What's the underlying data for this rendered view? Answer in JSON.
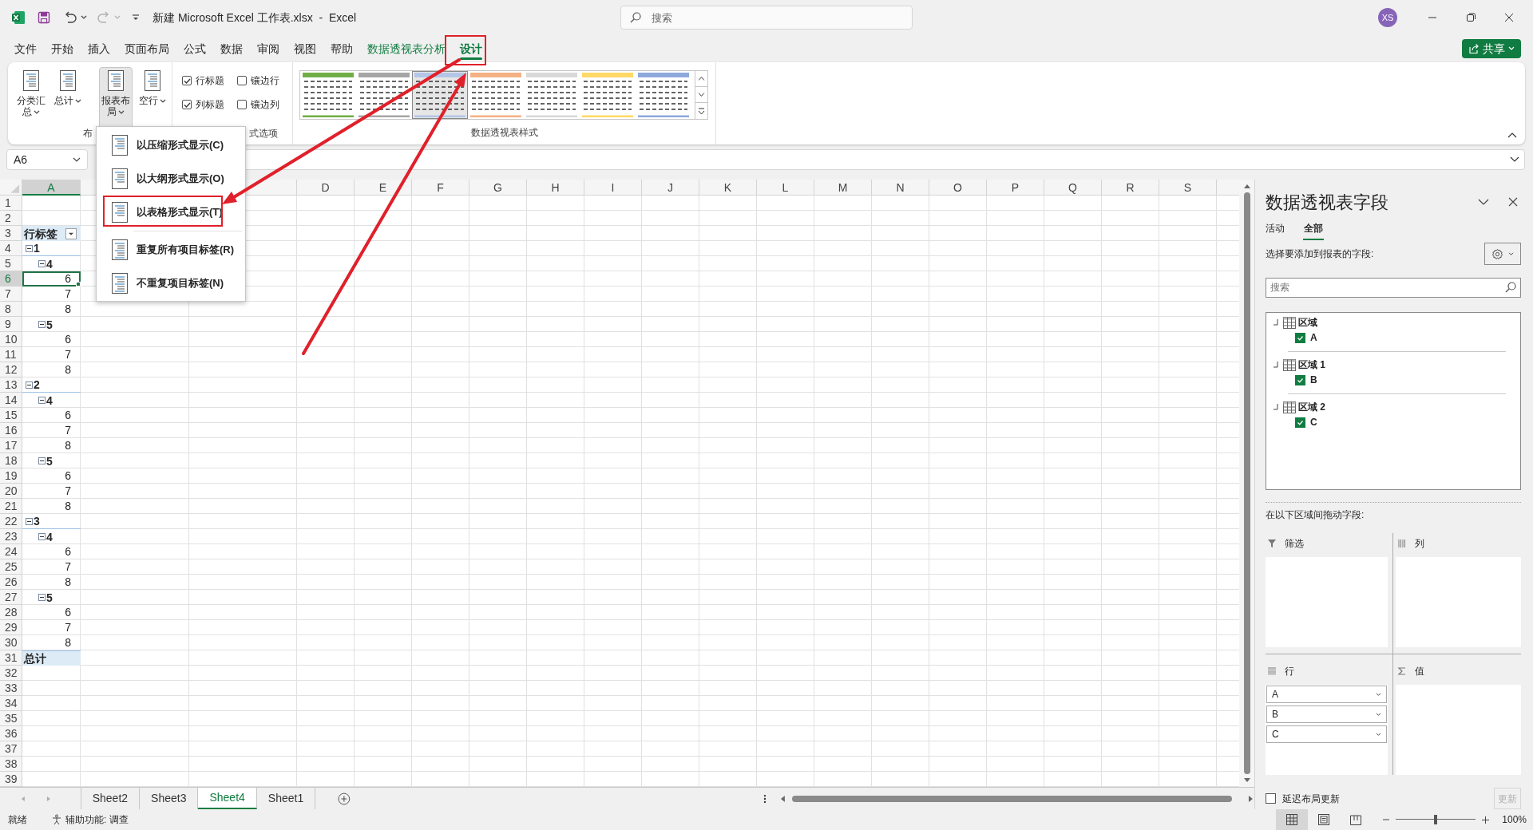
{
  "window": {
    "title": "新建 Microsoft Excel 工作表.xlsx  -  Excel",
    "search_placeholder": "搜索",
    "account": "XS"
  },
  "ribbon_tabs": [
    {
      "label": "文件",
      "selected": false,
      "contextual": false
    },
    {
      "label": "开始",
      "selected": false,
      "contextual": false
    },
    {
      "label": "插入",
      "selected": false,
      "contextual": false
    },
    {
      "label": "页面布局",
      "selected": false,
      "contextual": false
    },
    {
      "label": "公式",
      "selected": false,
      "contextual": false
    },
    {
      "label": "数据",
      "selected": false,
      "contextual": false
    },
    {
      "label": "审阅",
      "selected": false,
      "contextual": false
    },
    {
      "label": "视图",
      "selected": false,
      "contextual": false
    },
    {
      "label": "帮助",
      "selected": false,
      "contextual": false
    },
    {
      "label": "数据透视表分析",
      "selected": false,
      "contextual": true
    },
    {
      "label": "设计",
      "selected": true,
      "contextual": true
    }
  ],
  "share_button": "共享",
  "ribbon": {
    "layout_group": {
      "label": "布",
      "buttons": [
        {
          "label": "分类汇总",
          "pressed": false
        },
        {
          "label": "总计",
          "pressed": false
        },
        {
          "label": "报表布局",
          "pressed": true
        },
        {
          "label": "空行",
          "pressed": false
        }
      ]
    },
    "style_options": {
      "label": "式选项",
      "options": [
        {
          "label": "行标题",
          "checked": true
        },
        {
          "label": "镶边行",
          "checked": false
        },
        {
          "label": "列标题",
          "checked": true
        },
        {
          "label": "镶边列",
          "checked": false
        }
      ]
    },
    "styles": {
      "label": "数据透视表样式",
      "swatches": [
        {
          "color": "#70ad47",
          "selected": false
        },
        {
          "color": "#a6a6a6",
          "selected": false
        },
        {
          "color": "#b4c6e7",
          "selected": true
        },
        {
          "color": "#f4b183",
          "selected": false
        },
        {
          "color": "#d9d9d9",
          "selected": false
        },
        {
          "color": "#ffd966",
          "selected": false
        },
        {
          "color": "#8ea9db",
          "selected": false
        }
      ]
    }
  },
  "name_box": "A6",
  "layout_menu": {
    "items": [
      {
        "label": "以压缩形式显示(C)"
      },
      {
        "label": "以大纲形式显示(O)"
      },
      {
        "label": "以表格形式显示(T)"
      },
      {
        "label": "重复所有项目标签(R)"
      },
      {
        "label": "不重复项目标签(N)"
      }
    ]
  },
  "columns": [
    {
      "label": "A",
      "selected": true
    },
    {
      "label": "D",
      "selected": false
    },
    {
      "label": "E",
      "selected": false
    },
    {
      "label": "F",
      "selected": false
    },
    {
      "label": "G",
      "selected": false
    },
    {
      "label": "H",
      "selected": false
    },
    {
      "label": "I",
      "selected": false
    },
    {
      "label": "J",
      "selected": false
    },
    {
      "label": "K",
      "selected": false
    },
    {
      "label": "L",
      "selected": false
    },
    {
      "label": "M",
      "selected": false
    },
    {
      "label": "N",
      "selected": false
    },
    {
      "label": "O",
      "selected": false
    },
    {
      "label": "P",
      "selected": false
    },
    {
      "label": "Q",
      "selected": false
    },
    {
      "label": "R",
      "selected": false
    },
    {
      "label": "S",
      "selected": false
    }
  ],
  "row_numbers": [
    {
      "label": "1",
      "selected": false
    },
    {
      "label": "2",
      "selected": false
    },
    {
      "label": "3",
      "selected": false
    },
    {
      "label": "4",
      "selected": false
    },
    {
      "label": "5",
      "selected": false
    },
    {
      "label": "6",
      "selected": true
    },
    {
      "label": "7",
      "selected": false
    },
    {
      "label": "8",
      "selected": false
    },
    {
      "label": "9",
      "selected": false
    },
    {
      "label": "10",
      "selected": false
    },
    {
      "label": "11",
      "selected": false
    },
    {
      "label": "12",
      "selected": false
    },
    {
      "label": "13",
      "selected": false
    },
    {
      "label": "14",
      "selected": false
    },
    {
      "label": "15",
      "selected": false
    },
    {
      "label": "16",
      "selected": false
    },
    {
      "label": "17",
      "selected": false
    },
    {
      "label": "18",
      "selected": false
    },
    {
      "label": "19",
      "selected": false
    },
    {
      "label": "20",
      "selected": false
    },
    {
      "label": "21",
      "selected": false
    },
    {
      "label": "22",
      "selected": false
    },
    {
      "label": "23",
      "selected": false
    },
    {
      "label": "24",
      "selected": false
    },
    {
      "label": "25",
      "selected": false
    },
    {
      "label": "26",
      "selected": false
    },
    {
      "label": "27",
      "selected": false
    },
    {
      "label": "28",
      "selected": false
    },
    {
      "label": "29",
      "selected": false
    },
    {
      "label": "30",
      "selected": false
    },
    {
      "label": "31",
      "selected": false
    },
    {
      "label": "32",
      "selected": false
    },
    {
      "label": "33",
      "selected": false
    },
    {
      "label": "34",
      "selected": false
    },
    {
      "label": "35",
      "selected": false
    },
    {
      "label": "36",
      "selected": false
    },
    {
      "label": "37",
      "selected": false
    },
    {
      "label": "38",
      "selected": false
    },
    {
      "label": "39",
      "selected": false
    }
  ],
  "pivot": {
    "header": "行标签",
    "items": [
      {
        "label": "1",
        "expanded": true,
        "children": [
          {
            "label": "4",
            "expanded": true,
            "children": [
              {
                "label": "6",
                "selected": true
              },
              {
                "label": "7",
                "selected": false
              },
              {
                "label": "8",
                "selected": false
              }
            ]
          },
          {
            "label": "5",
            "expanded": true,
            "children": [
              {
                "label": "6",
                "selected": false
              },
              {
                "label": "7",
                "selected": false
              },
              {
                "label": "8",
                "selected": false
              }
            ]
          }
        ]
      },
      {
        "label": "2",
        "expanded": true,
        "children": [
          {
            "label": "4",
            "expanded": true,
            "children": [
              {
                "label": "6",
                "selected": false
              },
              {
                "label": "7",
                "selected": false
              },
              {
                "label": "8",
                "selected": false
              }
            ]
          },
          {
            "label": "5",
            "expanded": true,
            "children": [
              {
                "label": "6",
                "selected": false
              },
              {
                "label": "7",
                "selected": false
              },
              {
                "label": "8",
                "selected": false
              }
            ]
          }
        ]
      },
      {
        "label": "3",
        "expanded": true,
        "children": [
          {
            "label": "4",
            "expanded": true,
            "children": [
              {
                "label": "6",
                "selected": false
              },
              {
                "label": "7",
                "selected": false
              },
              {
                "label": "8",
                "selected": false
              }
            ]
          },
          {
            "label": "5",
            "expanded": true,
            "children": [
              {
                "label": "6",
                "selected": false
              },
              {
                "label": "7",
                "selected": false
              },
              {
                "label": "8",
                "selected": false
              }
            ]
          }
        ]
      }
    ],
    "total": "总计"
  },
  "field_pane": {
    "title": "数据透视表字段",
    "tabs": [
      {
        "label": "活动",
        "selected": false
      },
      {
        "label": "全部",
        "selected": true
      }
    ],
    "prompt": "选择要添加到报表的字段:",
    "search_placeholder": "搜索",
    "tables": [
      {
        "name": "区域",
        "expanded": true,
        "children": [
          {
            "name": "A",
            "checked": true
          }
        ]
      },
      {
        "name": "区域 1",
        "expanded": true,
        "children": [
          {
            "name": "B",
            "checked": true
          }
        ]
      },
      {
        "name": "区域 2",
        "expanded": true,
        "children": [
          {
            "name": "C",
            "checked": true
          }
        ]
      }
    ],
    "drag_prompt": "在以下区域间拖动字段:",
    "areas": [
      {
        "kind": "filter",
        "label": "筛选"
      },
      {
        "kind": "columns",
        "label": "列"
      },
      {
        "kind": "rows",
        "label": "行",
        "fields": [
          "A",
          "B",
          "C"
        ]
      },
      {
        "kind": "values",
        "label": "值"
      }
    ],
    "defer_update": {
      "label": "延迟布局更新",
      "checked": false
    },
    "update_button": {
      "label": "更新",
      "disabled": true
    }
  },
  "sheet_tabs": [
    {
      "label": "Sheet2",
      "selected": false
    },
    {
      "label": "Sheet3",
      "selected": false
    },
    {
      "label": "Sheet4",
      "selected": true
    },
    {
      "label": "Sheet1",
      "selected": false
    }
  ],
  "status_bar": {
    "ready": "就绪",
    "accessibility": "辅助功能: 调查",
    "views": [
      {
        "kind": "normal",
        "selected": true
      },
      {
        "kind": "page_layout",
        "selected": false
      },
      {
        "kind": "page_break",
        "selected": false
      }
    ],
    "zoom": {
      "level": 0.5
    },
    "zoom_label": "100%"
  }
}
